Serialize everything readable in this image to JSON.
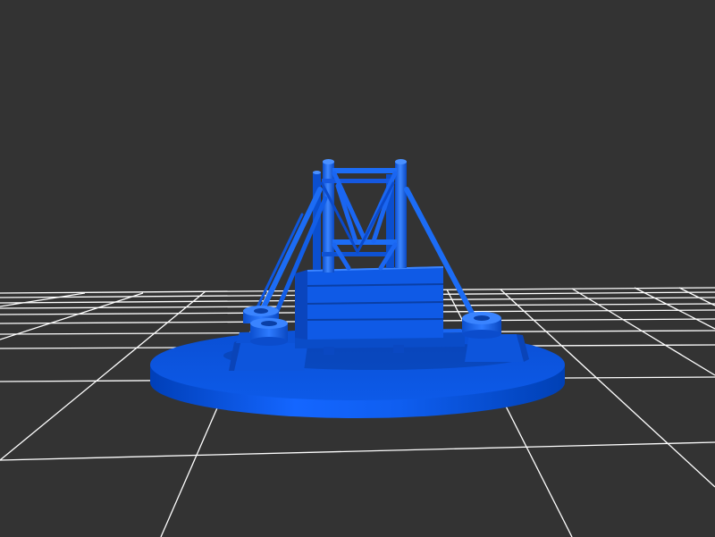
{
  "viewport": {
    "background_color": "#333333",
    "grid_color": "#ffffff"
  },
  "model": {
    "color": "#0a5cf0",
    "color_light": "#2f7bff",
    "color_dark": "#0040b0",
    "color_shadow": "#00256a"
  }
}
